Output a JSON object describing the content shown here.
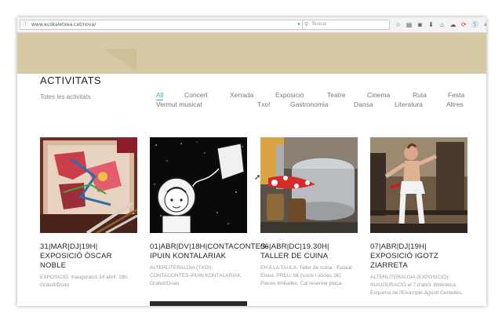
{
  "browser": {
    "url": "www.euskaletxea.cat/nova/",
    "search_placeholder": "Buscar",
    "toolbar_icons": [
      "star-icon",
      "reading-list-icon",
      "pocket-icon",
      "download-icon",
      "home-icon",
      "chat-icon",
      "sync-icon",
      "skype-icon",
      "menu-icon"
    ]
  },
  "colors": {
    "accent": "#3bb0a8",
    "banner": "#d6c9a6"
  },
  "page": {
    "title": "ACTIVITATS",
    "all_activities": "Totes les activitats"
  },
  "filters": [
    {
      "label": "All",
      "active": true
    },
    {
      "label": "Concert",
      "active": false
    },
    {
      "label": "Xerrada",
      "active": false
    },
    {
      "label": "Exposició",
      "active": false
    },
    {
      "label": "Teatre",
      "active": false
    },
    {
      "label": "Cinema",
      "active": false
    },
    {
      "label": "Ruta",
      "active": false
    },
    {
      "label": "Festa",
      "active": false
    },
    {
      "label": "Vermut musicat",
      "active": false
    },
    {
      "label": "Txo!",
      "active": false
    },
    {
      "label": "Gastronomia",
      "active": false
    },
    {
      "label": "Dansa",
      "active": false
    },
    {
      "label": "Literatura",
      "active": false
    },
    {
      "label": "Altres",
      "active": false
    }
  ],
  "cards": [
    {
      "title_line1": "31|MAR|DJ|19H|",
      "title_line2": "EXPOSICIÓ ÒSCAR",
      "title_line3": "NOBLE",
      "desc": "EXPOSICIÓ. Inauguració 14 abril. 19h. Gratuït/Doan"
    },
    {
      "title_line1": "01|ABR|DV|18H|CONTACONTES-",
      "title_line2": "IPUIN KONTALARIAK",
      "title_line3": "",
      "desc": "ALTERLITERALDIA (TXOI): CONTACONTES-IPUIN KONTALARIAK. Gratuït/Doan"
    },
    {
      "title_line1": "06|ABR|DC|19.30H|",
      "title_line2": "TALLER DE CUINA",
      "title_line3": "",
      "desc": "EH A LA TAULA: Taller de cuina - Euskal Etxea. PREU: 5€ (socis i sòcies 3€). Places limitades. Cal reservar plaça."
    },
    {
      "title_line1": "07|ABR|DJ|19H|",
      "title_line2": "EXPOSICIÓ IGOTZ",
      "title_line3": "ZIARRETA",
      "desc": "ALTERLITERALDIA (EXPOSICIÓ): INAUGURACIÓ el 7 d'abril. Biblioteca Esquerra de l'Eixample-Agustí Centelles."
    }
  ]
}
